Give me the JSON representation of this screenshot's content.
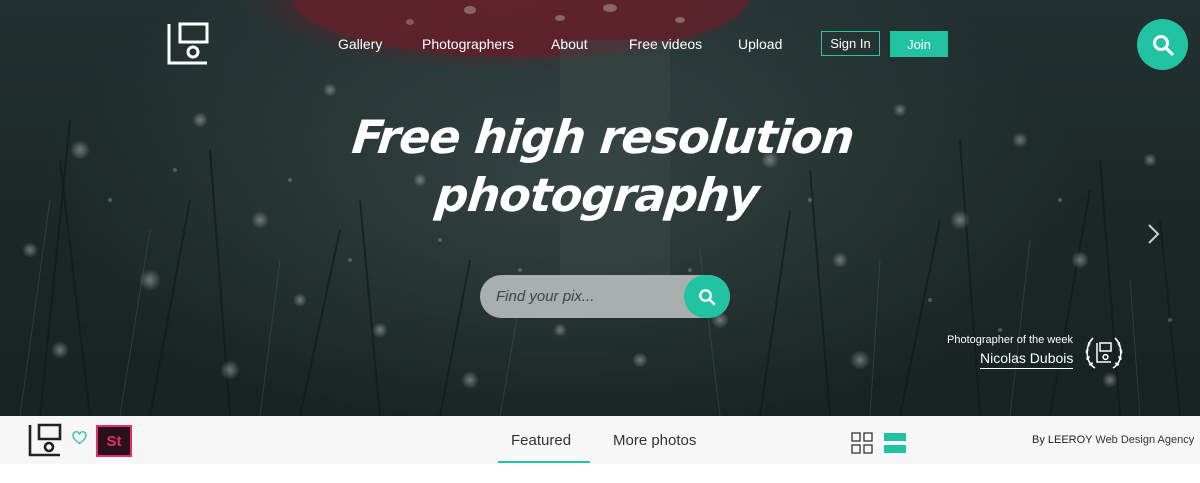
{
  "nav": {
    "items": [
      {
        "label": "Gallery"
      },
      {
        "label": "Photographers"
      },
      {
        "label": "About"
      },
      {
        "label": "Free videos"
      },
      {
        "label": "Upload"
      }
    ],
    "sign_in": "Sign In",
    "join": "Join"
  },
  "hero": {
    "headline_line1": "Free high resolution",
    "headline_line2": "photography"
  },
  "search": {
    "placeholder": "Find your pix..."
  },
  "potw": {
    "label": "Photographer of the week",
    "name": "Nicolas Dubois"
  },
  "bar": {
    "st_label": "St",
    "tabs": [
      {
        "label": "Featured"
      },
      {
        "label": "More photos"
      }
    ],
    "credit_prefix": "By LEEROY",
    "credit_suffix": " Web Design Agency"
  },
  "colors": {
    "accent": "#22c3a3",
    "stock_badge": "#e62f6a"
  },
  "icons": {
    "logo": "picjumbo-logo-icon",
    "search": "search-icon",
    "chevron": "chevron-right-icon",
    "laurel": "laurel-badge-icon",
    "heart": "heart-icon",
    "grid": "grid-view-icon",
    "list": "list-view-icon"
  }
}
